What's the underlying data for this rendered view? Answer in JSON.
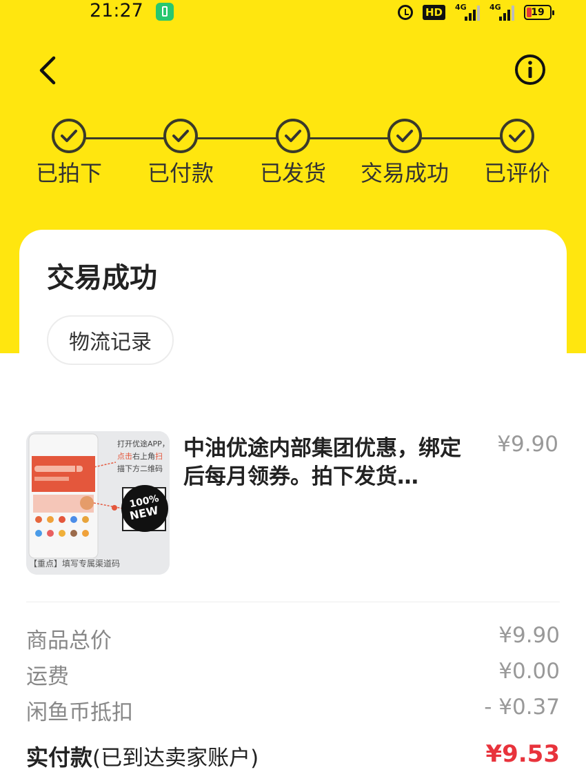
{
  "status_bar": {
    "time": "21:27",
    "hd": "HD",
    "network_a": "4G",
    "network_b": "4G",
    "battery": "19"
  },
  "progress": {
    "steps": [
      {
        "label": "已拍下"
      },
      {
        "label": "已付款"
      },
      {
        "label": "已发货"
      },
      {
        "label": "交易成功"
      },
      {
        "label": "已评价"
      }
    ]
  },
  "status_card": {
    "title": "交易成功",
    "logistics_button": "物流记录"
  },
  "product": {
    "title": "中油优途内部集团优惠，绑定后每月领券。拍下发货…",
    "price": "¥9.90",
    "thumbnail": {
      "line1": "打开优途APP，",
      "line2a": "点击",
      "line2b": "右上角",
      "line2c": "扫",
      "line3": "描下方二维码",
      "badge_a": "100%",
      "badge_b": "NEW",
      "caption": "【重点】填写专属渠道码"
    }
  },
  "summary": {
    "goods_total_label": "商品总价",
    "goods_total": "¥9.90",
    "shipping_label": "运费",
    "shipping": "¥0.00",
    "coin_label": "闲鱼币抵扣",
    "coin": "- ¥0.37",
    "paid_label_bold": "实付款",
    "paid_label_note": "(已到达卖家账户)",
    "paid": "¥9.53"
  },
  "colors": {
    "brand_yellow": "#ffe60f",
    "price_red": "#e8333c"
  },
  "icons": [
    "back-arrow-icon",
    "info-icon",
    "check-icon",
    "alarm-icon",
    "battery-icon",
    "charging-icon"
  ]
}
